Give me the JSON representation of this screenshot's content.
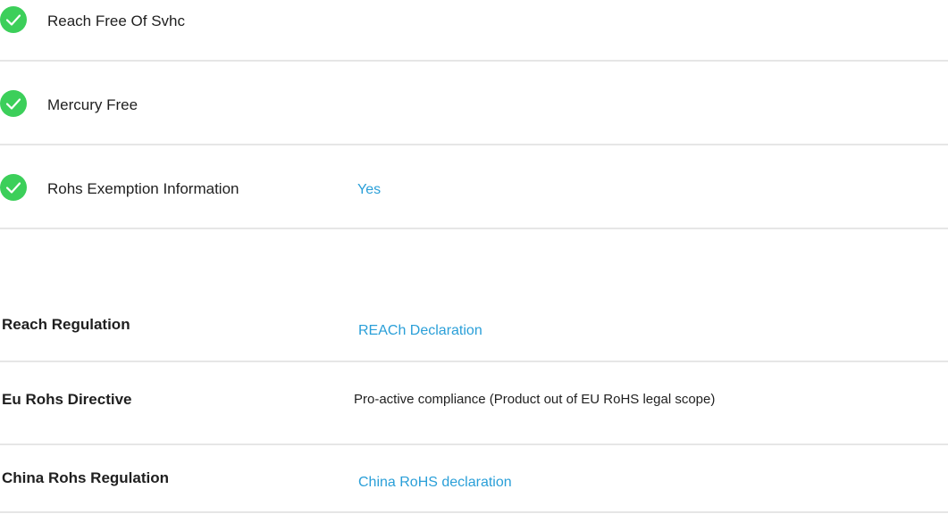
{
  "compliance_checks": [
    {
      "label": "Reach Free Of Svhc",
      "value": "",
      "status_icon": "check-circle-icon"
    },
    {
      "label": "Mercury Free",
      "value": "",
      "status_icon": "check-circle-icon"
    },
    {
      "label": "Rohs Exemption Information",
      "value": "Yes",
      "status_icon": "check-circle-icon"
    }
  ],
  "regulations": [
    {
      "label": "Reach Regulation",
      "value": "REACh Declaration",
      "value_type": "link"
    },
    {
      "label": "Eu Rohs Directive",
      "value": "Pro-active compliance (Product out of EU RoHS legal scope)",
      "value_type": "text"
    },
    {
      "label": "China Rohs Regulation",
      "value": "China RoHS declaration",
      "value_type": "link"
    }
  ],
  "colors": {
    "check_green": "#3ccf5a",
    "link_blue": "#2a9fd8",
    "divider": "#e6e6e6"
  }
}
